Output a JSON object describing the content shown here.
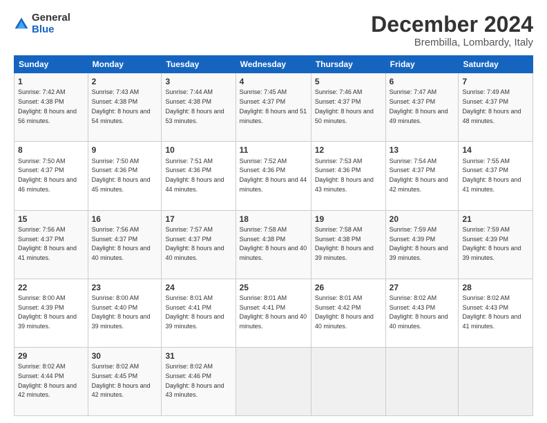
{
  "logo": {
    "general": "General",
    "blue": "Blue"
  },
  "header": {
    "month": "December 2024",
    "location": "Brembilla, Lombardy, Italy"
  },
  "days_of_week": [
    "Sunday",
    "Monday",
    "Tuesday",
    "Wednesday",
    "Thursday",
    "Friday",
    "Saturday"
  ],
  "weeks": [
    [
      {
        "day": "1",
        "sunrise": "7:42 AM",
        "sunset": "4:38 PM",
        "daylight": "8 hours and 56 minutes."
      },
      {
        "day": "2",
        "sunrise": "7:43 AM",
        "sunset": "4:38 PM",
        "daylight": "8 hours and 54 minutes."
      },
      {
        "day": "3",
        "sunrise": "7:44 AM",
        "sunset": "4:38 PM",
        "daylight": "8 hours and 53 minutes."
      },
      {
        "day": "4",
        "sunrise": "7:45 AM",
        "sunset": "4:37 PM",
        "daylight": "8 hours and 51 minutes."
      },
      {
        "day": "5",
        "sunrise": "7:46 AM",
        "sunset": "4:37 PM",
        "daylight": "8 hours and 50 minutes."
      },
      {
        "day": "6",
        "sunrise": "7:47 AM",
        "sunset": "4:37 PM",
        "daylight": "8 hours and 49 minutes."
      },
      {
        "day": "7",
        "sunrise": "7:49 AM",
        "sunset": "4:37 PM",
        "daylight": "8 hours and 48 minutes."
      }
    ],
    [
      {
        "day": "8",
        "sunrise": "7:50 AM",
        "sunset": "4:37 PM",
        "daylight": "8 hours and 46 minutes."
      },
      {
        "day": "9",
        "sunrise": "7:50 AM",
        "sunset": "4:36 PM",
        "daylight": "8 hours and 45 minutes."
      },
      {
        "day": "10",
        "sunrise": "7:51 AM",
        "sunset": "4:36 PM",
        "daylight": "8 hours and 44 minutes."
      },
      {
        "day": "11",
        "sunrise": "7:52 AM",
        "sunset": "4:36 PM",
        "daylight": "8 hours and 44 minutes."
      },
      {
        "day": "12",
        "sunrise": "7:53 AM",
        "sunset": "4:36 PM",
        "daylight": "8 hours and 43 minutes."
      },
      {
        "day": "13",
        "sunrise": "7:54 AM",
        "sunset": "4:37 PM",
        "daylight": "8 hours and 42 minutes."
      },
      {
        "day": "14",
        "sunrise": "7:55 AM",
        "sunset": "4:37 PM",
        "daylight": "8 hours and 41 minutes."
      }
    ],
    [
      {
        "day": "15",
        "sunrise": "7:56 AM",
        "sunset": "4:37 PM",
        "daylight": "8 hours and 41 minutes."
      },
      {
        "day": "16",
        "sunrise": "7:56 AM",
        "sunset": "4:37 PM",
        "daylight": "8 hours and 40 minutes."
      },
      {
        "day": "17",
        "sunrise": "7:57 AM",
        "sunset": "4:37 PM",
        "daylight": "8 hours and 40 minutes."
      },
      {
        "day": "18",
        "sunrise": "7:58 AM",
        "sunset": "4:38 PM",
        "daylight": "8 hours and 40 minutes."
      },
      {
        "day": "19",
        "sunrise": "7:58 AM",
        "sunset": "4:38 PM",
        "daylight": "8 hours and 39 minutes."
      },
      {
        "day": "20",
        "sunrise": "7:59 AM",
        "sunset": "4:39 PM",
        "daylight": "8 hours and 39 minutes."
      },
      {
        "day": "21",
        "sunrise": "7:59 AM",
        "sunset": "4:39 PM",
        "daylight": "8 hours and 39 minutes."
      }
    ],
    [
      {
        "day": "22",
        "sunrise": "8:00 AM",
        "sunset": "4:39 PM",
        "daylight": "8 hours and 39 minutes."
      },
      {
        "day": "23",
        "sunrise": "8:00 AM",
        "sunset": "4:40 PM",
        "daylight": "8 hours and 39 minutes."
      },
      {
        "day": "24",
        "sunrise": "8:01 AM",
        "sunset": "4:41 PM",
        "daylight": "8 hours and 39 minutes."
      },
      {
        "day": "25",
        "sunrise": "8:01 AM",
        "sunset": "4:41 PM",
        "daylight": "8 hours and 40 minutes."
      },
      {
        "day": "26",
        "sunrise": "8:01 AM",
        "sunset": "4:42 PM",
        "daylight": "8 hours and 40 minutes."
      },
      {
        "day": "27",
        "sunrise": "8:02 AM",
        "sunset": "4:43 PM",
        "daylight": "8 hours and 40 minutes."
      },
      {
        "day": "28",
        "sunrise": "8:02 AM",
        "sunset": "4:43 PM",
        "daylight": "8 hours and 41 minutes."
      }
    ],
    [
      {
        "day": "29",
        "sunrise": "8:02 AM",
        "sunset": "4:44 PM",
        "daylight": "8 hours and 42 minutes."
      },
      {
        "day": "30",
        "sunrise": "8:02 AM",
        "sunset": "4:45 PM",
        "daylight": "8 hours and 42 minutes."
      },
      {
        "day": "31",
        "sunrise": "8:02 AM",
        "sunset": "4:46 PM",
        "daylight": "8 hours and 43 minutes."
      },
      null,
      null,
      null,
      null
    ]
  ]
}
